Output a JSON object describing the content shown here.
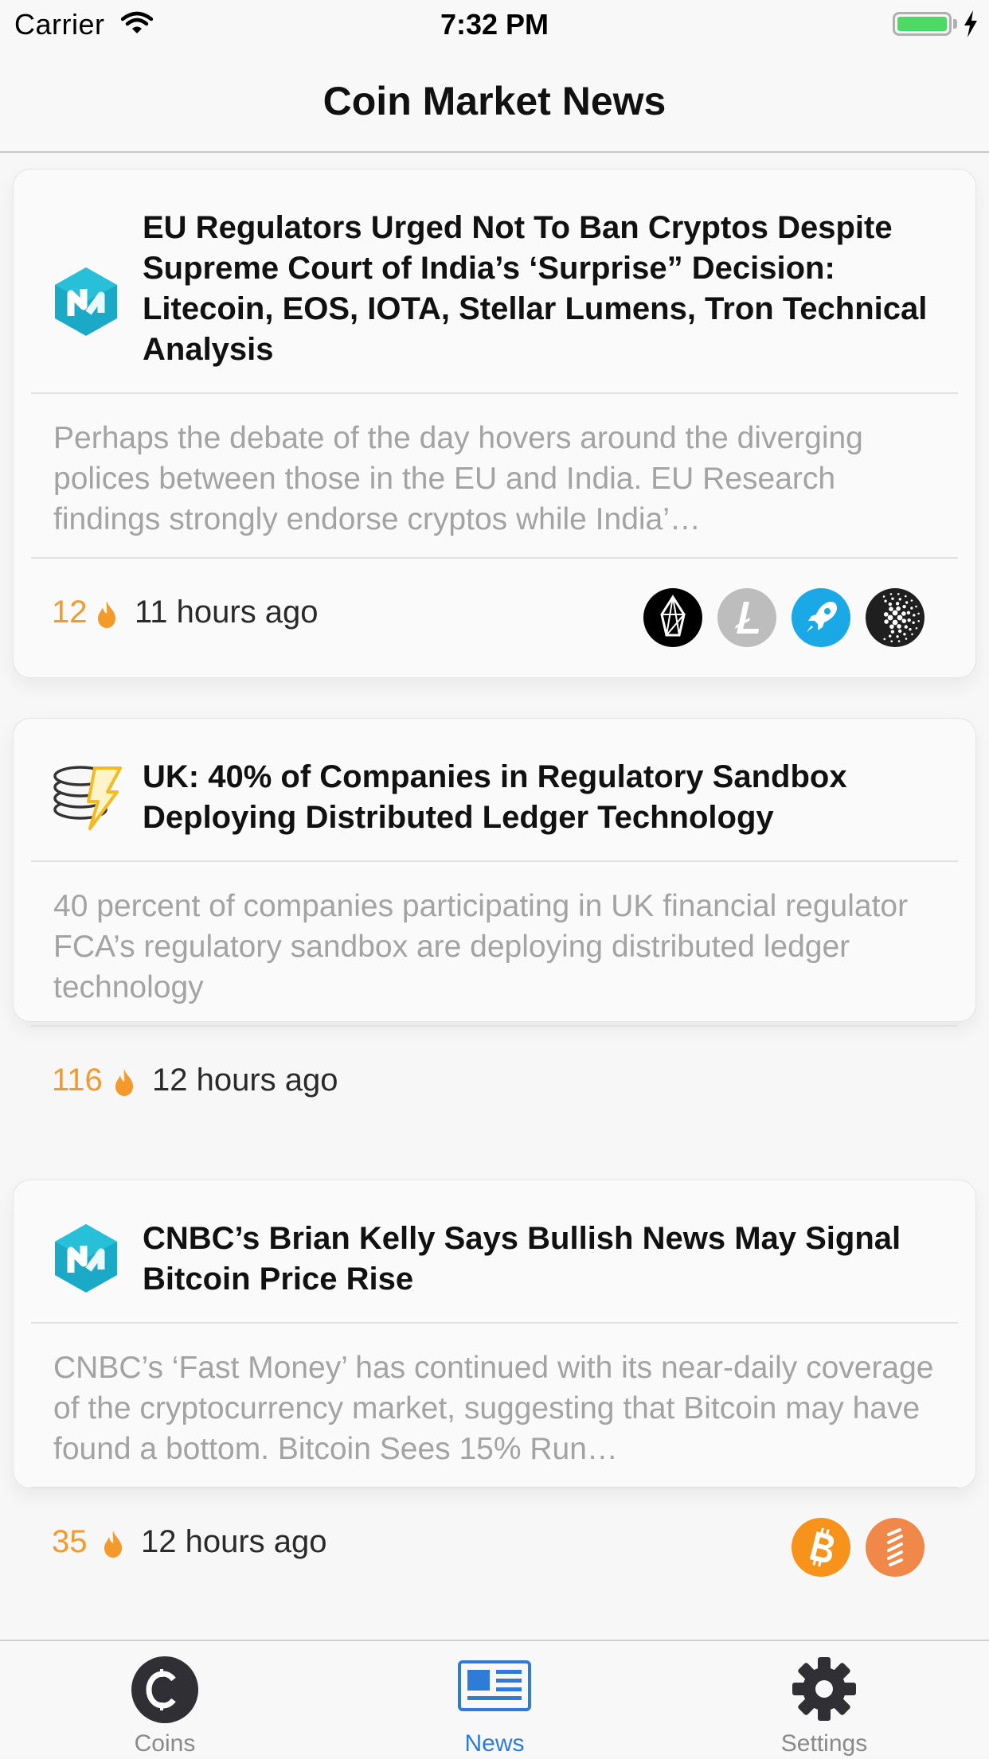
{
  "status_bar": {
    "carrier": "Carrier",
    "time": "7:32 PM"
  },
  "nav": {
    "title": "Coin Market News"
  },
  "colors": {
    "accent": "#2e7bd8",
    "score": "#f39a2b",
    "battery": "#4cd964"
  },
  "articles": [
    {
      "source_icon": "coin-market-news-icon",
      "title": "EU Regulators Urged Not To Ban Cryptos Despite Supreme Court of India’s ‘Surprise” Decision: Litecoin, EOS, IOTA, Stellar Lumens, Tron Technical Analysis",
      "summary": "Perhaps the debate of the day hovers around the diverging polices between those in the EU and India. EU Research findings strongly endorse cryptos while India’…",
      "score": "12",
      "time": "11 hours ago",
      "coins": [
        "eos-icon",
        "litecoin-icon",
        "stellar-icon",
        "iota-icon"
      ]
    },
    {
      "source_icon": "coin-stack-lightning-icon",
      "title": "UK: 40% of Companies in Regulatory Sandbox Deploying Distributed Ledger Technology",
      "summary": "40 percent of companies participating in UK financial regulator FCA’s regulatory sandbox are deploying distributed ledger technology",
      "score": "116",
      "time": "12 hours ago",
      "coins": []
    },
    {
      "source_icon": "coin-market-news-icon",
      "title": "CNBC’s Brian Kelly Says Bullish News May Signal Bitcoin Price Rise",
      "summary": "CNBC’s ‘Fast Money’ has continued with its near-daily coverage of the cryptocurrency market, suggesting that Bitcoin may have found a bottom. Bitcoin Sees 15% Run…",
      "score": "35",
      "time": "12 hours ago",
      "coins": [
        "bitcoin-icon",
        "fast-money-icon"
      ]
    }
  ],
  "tabs": [
    {
      "label": "Coins",
      "icon": "coins-icon",
      "active": false
    },
    {
      "label": "News",
      "icon": "newspaper-icon",
      "active": true
    },
    {
      "label": "Settings",
      "icon": "gear-icon",
      "active": false
    }
  ]
}
